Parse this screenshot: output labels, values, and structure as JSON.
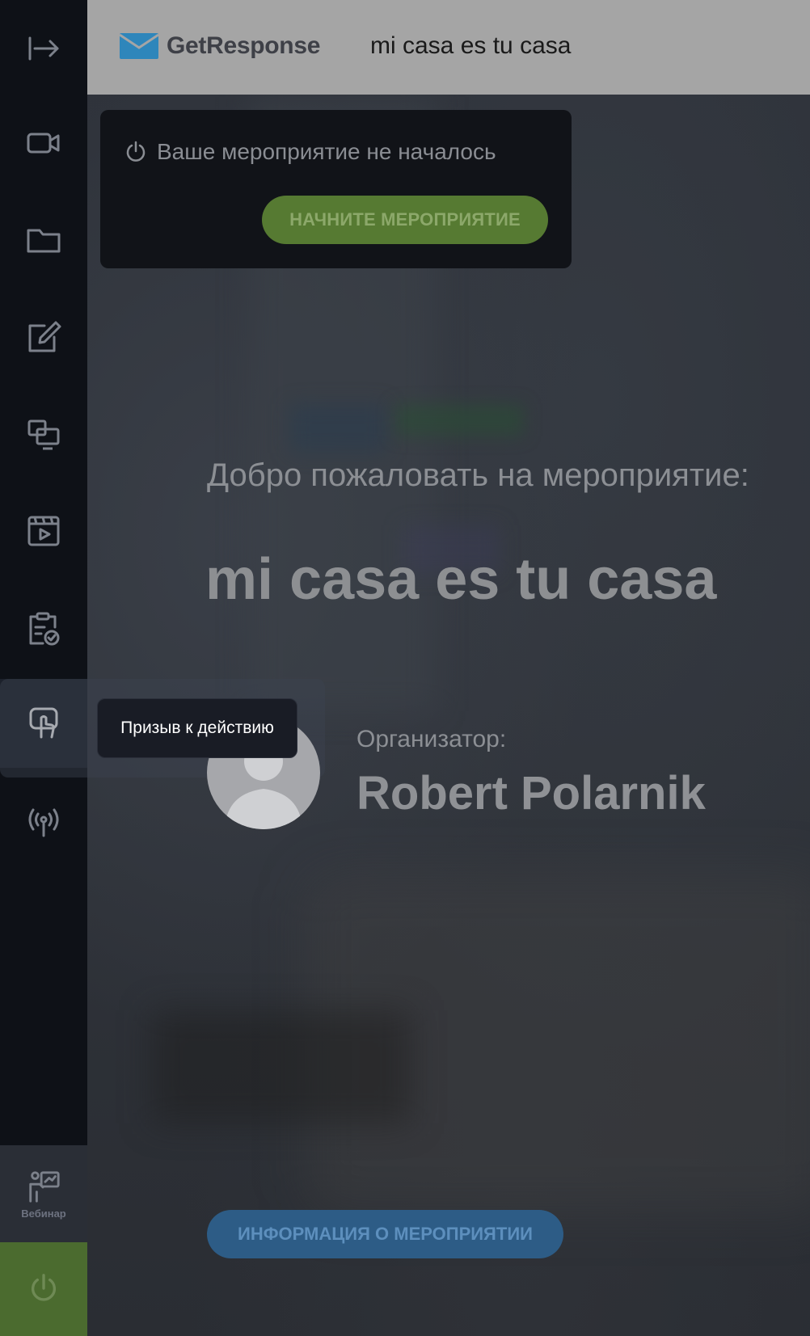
{
  "header": {
    "logo_text": "GetResponse",
    "event_title": "mi casa es tu casa"
  },
  "sidebar": {
    "items": [
      {
        "icon": "collapse-arrow-icon"
      },
      {
        "icon": "video-camera-icon"
      },
      {
        "icon": "folder-icon"
      },
      {
        "icon": "edit-icon"
      },
      {
        "icon": "screen-share-icon"
      },
      {
        "icon": "media-player-icon"
      },
      {
        "icon": "clipboard-check-icon"
      },
      {
        "icon": "call-to-action-icon",
        "tooltip": "Призыв к действию",
        "active": true
      },
      {
        "icon": "broadcast-icon"
      }
    ],
    "webinar_label": "Вебинар",
    "power_icon": "power-icon"
  },
  "panel": {
    "status": "Ваше мероприятие не началось",
    "start_button": "НАЧНИТЕ МЕРОПРИЯТИЕ"
  },
  "main": {
    "welcome": "Добро пожаловать на мероприятие:",
    "event_title": "mi casa es tu casa",
    "organizer_label": "Организатор:",
    "organizer_name": "Robert Polarnik",
    "info_button": "ИНФОРМАЦИЯ О МЕРОПРИЯТИИ"
  },
  "colors": {
    "sidebar_bg": "#0e1117",
    "start_green": "#567a32",
    "info_blue": "#2d5c86",
    "logo_blue": "#1a9fd9"
  }
}
